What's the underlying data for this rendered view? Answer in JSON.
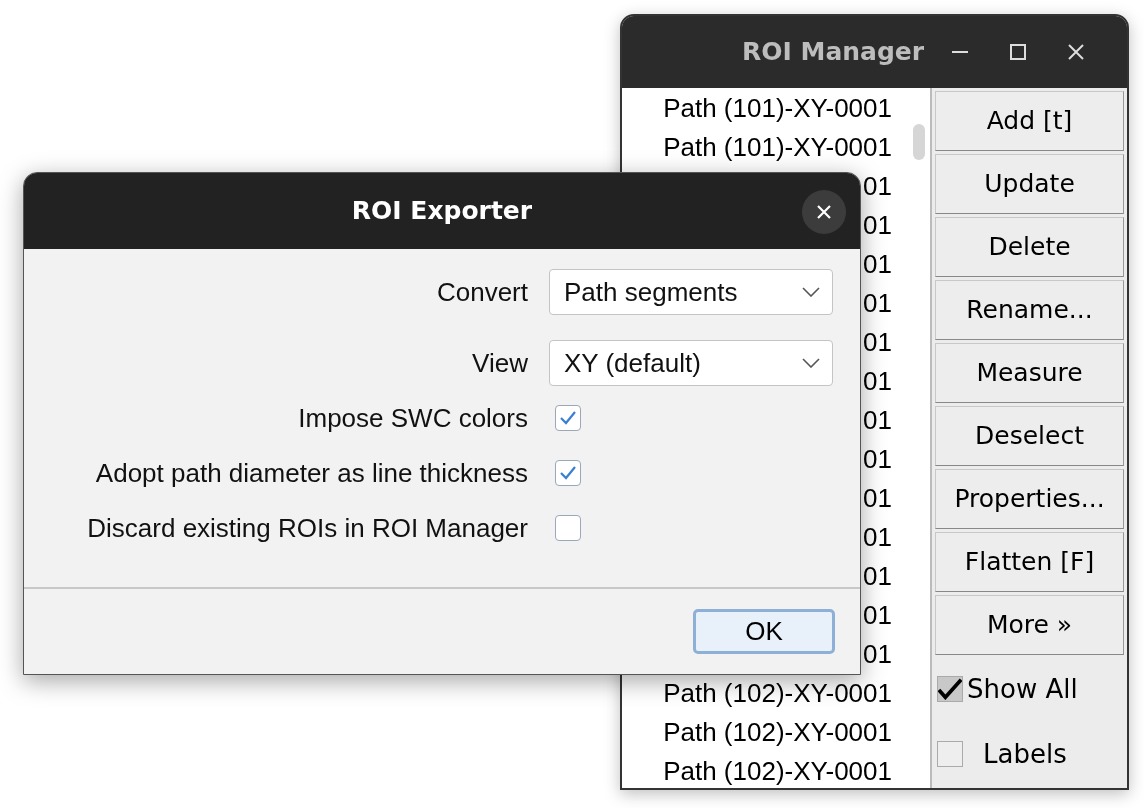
{
  "roi_manager": {
    "title": "ROI Manager",
    "rows": [
      {
        "text": "Path (101)-XY-0001"
      },
      {
        "text": "Path (101)-XY-0001"
      },
      {
        "text": "01"
      },
      {
        "text": "01"
      },
      {
        "text": "01"
      },
      {
        "text": "01"
      },
      {
        "text": "01"
      },
      {
        "text": "01"
      },
      {
        "text": "01"
      },
      {
        "text": "01"
      },
      {
        "text": "01"
      },
      {
        "text": "01"
      },
      {
        "text": "01"
      },
      {
        "text": "01"
      },
      {
        "text": "01"
      },
      {
        "text": "Path (102)-XY-0001"
      },
      {
        "text": "Path (102)-XY-0001"
      },
      {
        "text": "Path (102)-XY-0001"
      }
    ],
    "buttons": [
      "Add [t]",
      "Update",
      "Delete",
      "Rename...",
      "Measure",
      "Deselect",
      "Properties...",
      "Flatten [F]",
      "More »"
    ],
    "checkboxes": [
      {
        "label": "Show All",
        "checked": true
      },
      {
        "label": "Labels",
        "checked": false
      }
    ]
  },
  "dialog": {
    "title": "ROI Exporter",
    "fields": [
      {
        "kind": "dropdown",
        "label": "Convert",
        "value": "Path segments"
      },
      {
        "kind": "dropdown",
        "label": "View",
        "value": "XY (default)"
      },
      {
        "kind": "checkbox",
        "label": "Impose SWC colors",
        "checked": true
      },
      {
        "kind": "checkbox",
        "label": "Adopt path diameter as line thickness",
        "checked": true
      },
      {
        "kind": "checkbox",
        "label": "Discard existing ROIs in ROI Manager",
        "checked": false
      }
    ],
    "buttons": [
      "OK"
    ]
  }
}
